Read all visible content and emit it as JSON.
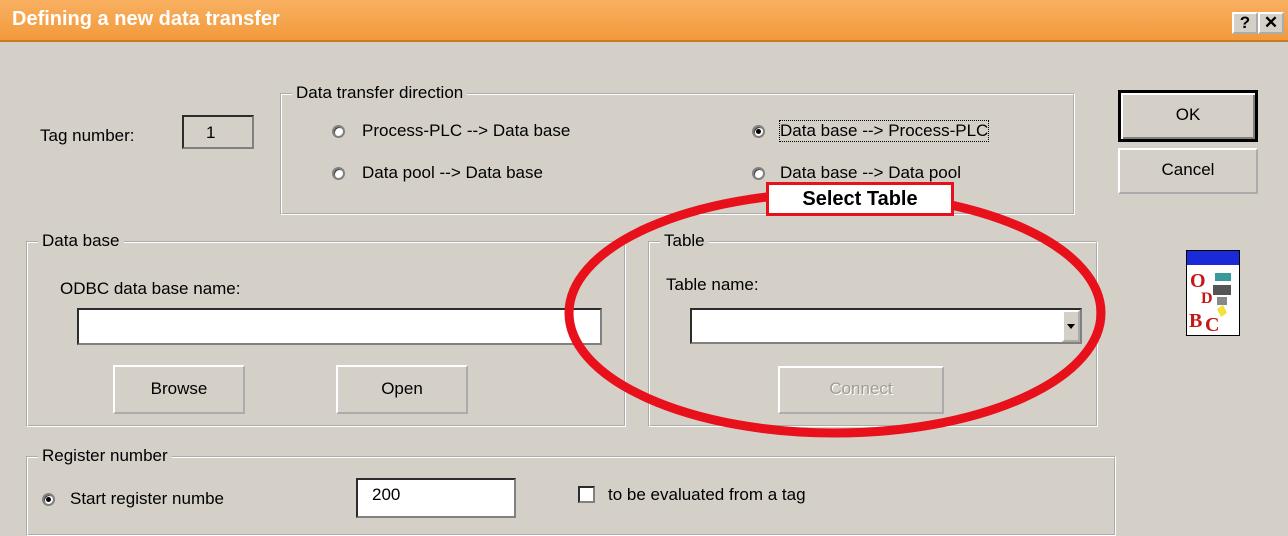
{
  "window": {
    "title": "Defining a new data transfer",
    "help_btn": "?",
    "close_btn": "✕"
  },
  "tag": {
    "label": "Tag number:",
    "value": "1"
  },
  "direction": {
    "legend": "Data transfer direction",
    "options": [
      {
        "text": "Process-PLC --> Data base",
        "checked": false
      },
      {
        "text": "Data base --> Process-PLC",
        "checked": true
      },
      {
        "text": "Data pool --> Data base",
        "checked": false
      },
      {
        "text": "Data base --> Data pool",
        "checked": false
      }
    ]
  },
  "buttons": {
    "ok": "OK",
    "cancel": "Cancel",
    "browse": "Browse",
    "open": "Open",
    "connect": "Connect"
  },
  "database": {
    "legend": "Data base",
    "odbc_label": "ODBC data base name:",
    "odbc_value": ""
  },
  "table": {
    "legend": "Table",
    "name_label": "Table name:",
    "name_value": ""
  },
  "annotation": {
    "label": "Select Table",
    "color": "#e8101a"
  },
  "register": {
    "legend": "Register number",
    "start_label": "Start register numbe",
    "start_value": "200",
    "tag_eval_label": "to be evaluated from a tag"
  },
  "icon": "odbc-icon"
}
